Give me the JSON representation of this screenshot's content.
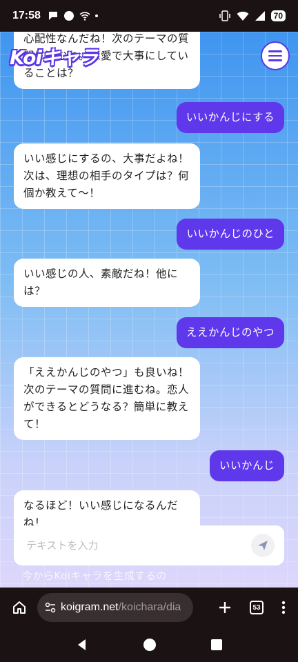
{
  "status_bar": {
    "time": "17:58",
    "battery": "70"
  },
  "app": {
    "logo": "Koiキャラ",
    "menu_icon": "hamburger-menu-icon"
  },
  "chat": {
    "messages": [
      {
        "from": "bot",
        "text": "心配性なんだね！次のテーマの質問に進むね。恋愛で大事にしていることは？"
      },
      {
        "from": "user",
        "text": "いいかんじにする"
      },
      {
        "from": "bot",
        "text": "いい感じにするの、大事だよね！次は、理想の相手のタイプは？何個か教えて〜！"
      },
      {
        "from": "user",
        "text": "いいかんじのひと"
      },
      {
        "from": "bot",
        "text": "いい感じの人、素敵だね！他には？"
      },
      {
        "from": "user",
        "text": "ええかんじのやつ"
      },
      {
        "from": "bot",
        "text": "「ええかんじのやつ」も良いね！次のテーマの質問に進むね。恋人ができるとどうなる？簡単に教えて！"
      },
      {
        "from": "user",
        "text": "いいかんじ"
      },
      {
        "from": "bot",
        "text": "なるほど！いい感じになるんだね！"
      }
    ],
    "input_placeholder": "テキストを入力",
    "below_text": "今からKoiキャラを生成するの"
  },
  "browser": {
    "url_host": "koigram.net",
    "url_path": "/koichara/dia",
    "tab_count": "53"
  }
}
